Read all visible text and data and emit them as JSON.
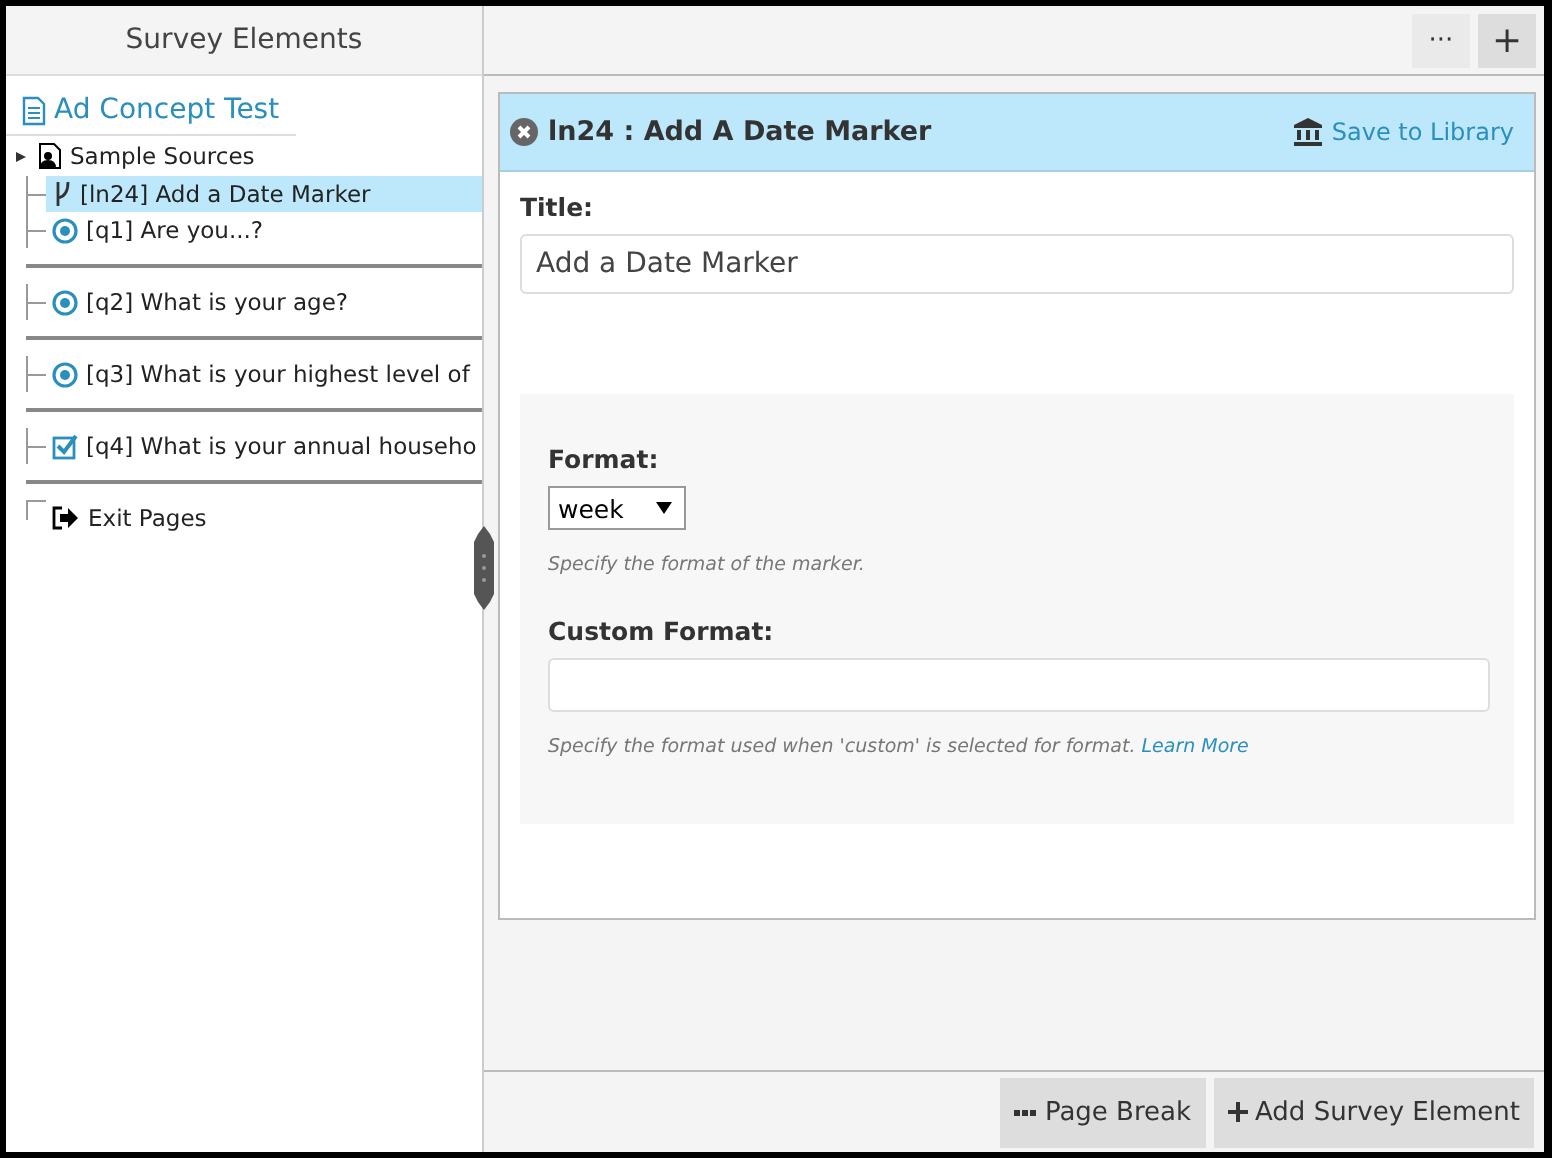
{
  "sidebar": {
    "title": "Survey Elements",
    "survey": "Ad Concept Test",
    "items": [
      {
        "kind": "sources",
        "label": "Sample Sources",
        "selected": false,
        "expanded": false,
        "page_break_after": false
      },
      {
        "kind": "marker",
        "label": "[ln24] Add a Date Marker",
        "selected": true,
        "page_break_after": false
      },
      {
        "kind": "radio",
        "label": "[q1] Are you...?",
        "selected": false,
        "page_break_after": true
      },
      {
        "kind": "radio",
        "label": "[q2] What is your age?",
        "selected": false,
        "page_break_after": true
      },
      {
        "kind": "radio",
        "label": "[q3] What is your highest level of",
        "selected": false,
        "page_break_after": true
      },
      {
        "kind": "checkbox",
        "label": "[q4] What is your annual househo",
        "selected": false,
        "page_break_after": true
      },
      {
        "kind": "exit",
        "label": "Exit Pages",
        "selected": false,
        "page_break_after": false
      }
    ]
  },
  "toolbar": {
    "buttons": [
      {
        "kind": "more",
        "label": "···"
      },
      {
        "kind": "add",
        "label": "+"
      }
    ]
  },
  "editor": {
    "header": "ln24 : Add A Date Marker",
    "save_link": "Save to Library",
    "title_label": "Title:",
    "title_value": "Add a Date Marker",
    "format_label": "Format:",
    "format_value": "week",
    "format_hint": "Specify the format of the marker.",
    "custom_label": "Custom Format:",
    "custom_hint": "Specify the format used when 'custom' is selected for format.",
    "custom_link": "Learn More"
  },
  "footer": {
    "buttons": [
      {
        "kind": "page-break",
        "label": "Page Break"
      },
      {
        "kind": "add",
        "label": "Add Survey Element"
      }
    ]
  }
}
